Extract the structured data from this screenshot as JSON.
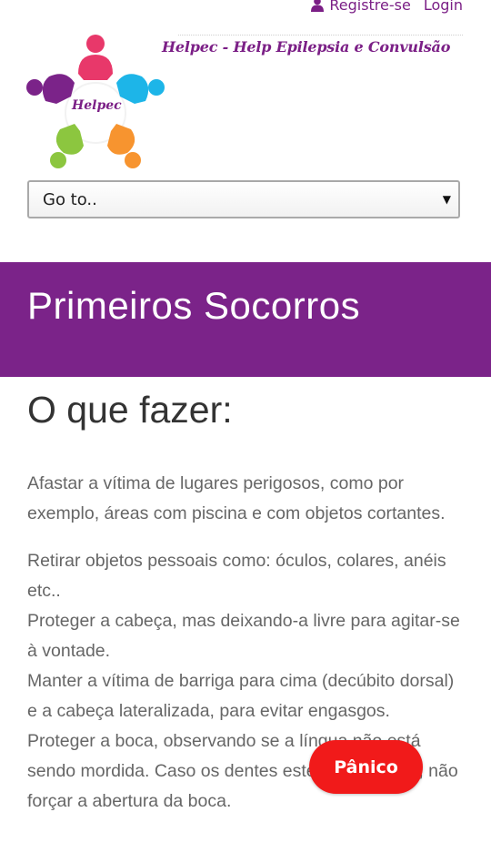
{
  "header": {
    "register_label": "Registre-se",
    "login_label": "Login",
    "site_title": "Helpec - Help Epilepsia e Convulsão",
    "logo_text": "Helpec"
  },
  "nav": {
    "goto_value": "Go to.."
  },
  "banner": {
    "title": "Primeiros Socorros"
  },
  "main": {
    "heading": "O que fazer:",
    "paragraph1": "Afastar a vítima de lugares perigosos, como por exemplo, áreas com piscina e com objetos cortantes.",
    "paragraph2_lines": [
      "Retirar objetos pessoais como: óculos, colares, anéis etc..",
      "Proteger a cabeça, mas deixando-a livre para agitar-se à vontade.",
      "Manter a vítima de barriga para cima (decúbito dorsal) e a cabeça lateralizada, para evitar engasgos.",
      "Proteger a boca, observando se a língua não está sendo mordida. Caso os dentes estejam cerrados, não forçar a abertura da boca."
    ]
  },
  "panic_button": {
    "label": "Pânico"
  },
  "colors": {
    "brand_purple": "#7b2389",
    "panic_red": "#f11a1a"
  },
  "icons": {
    "user": "user-icon",
    "select_caret": "caret-down-icon"
  }
}
